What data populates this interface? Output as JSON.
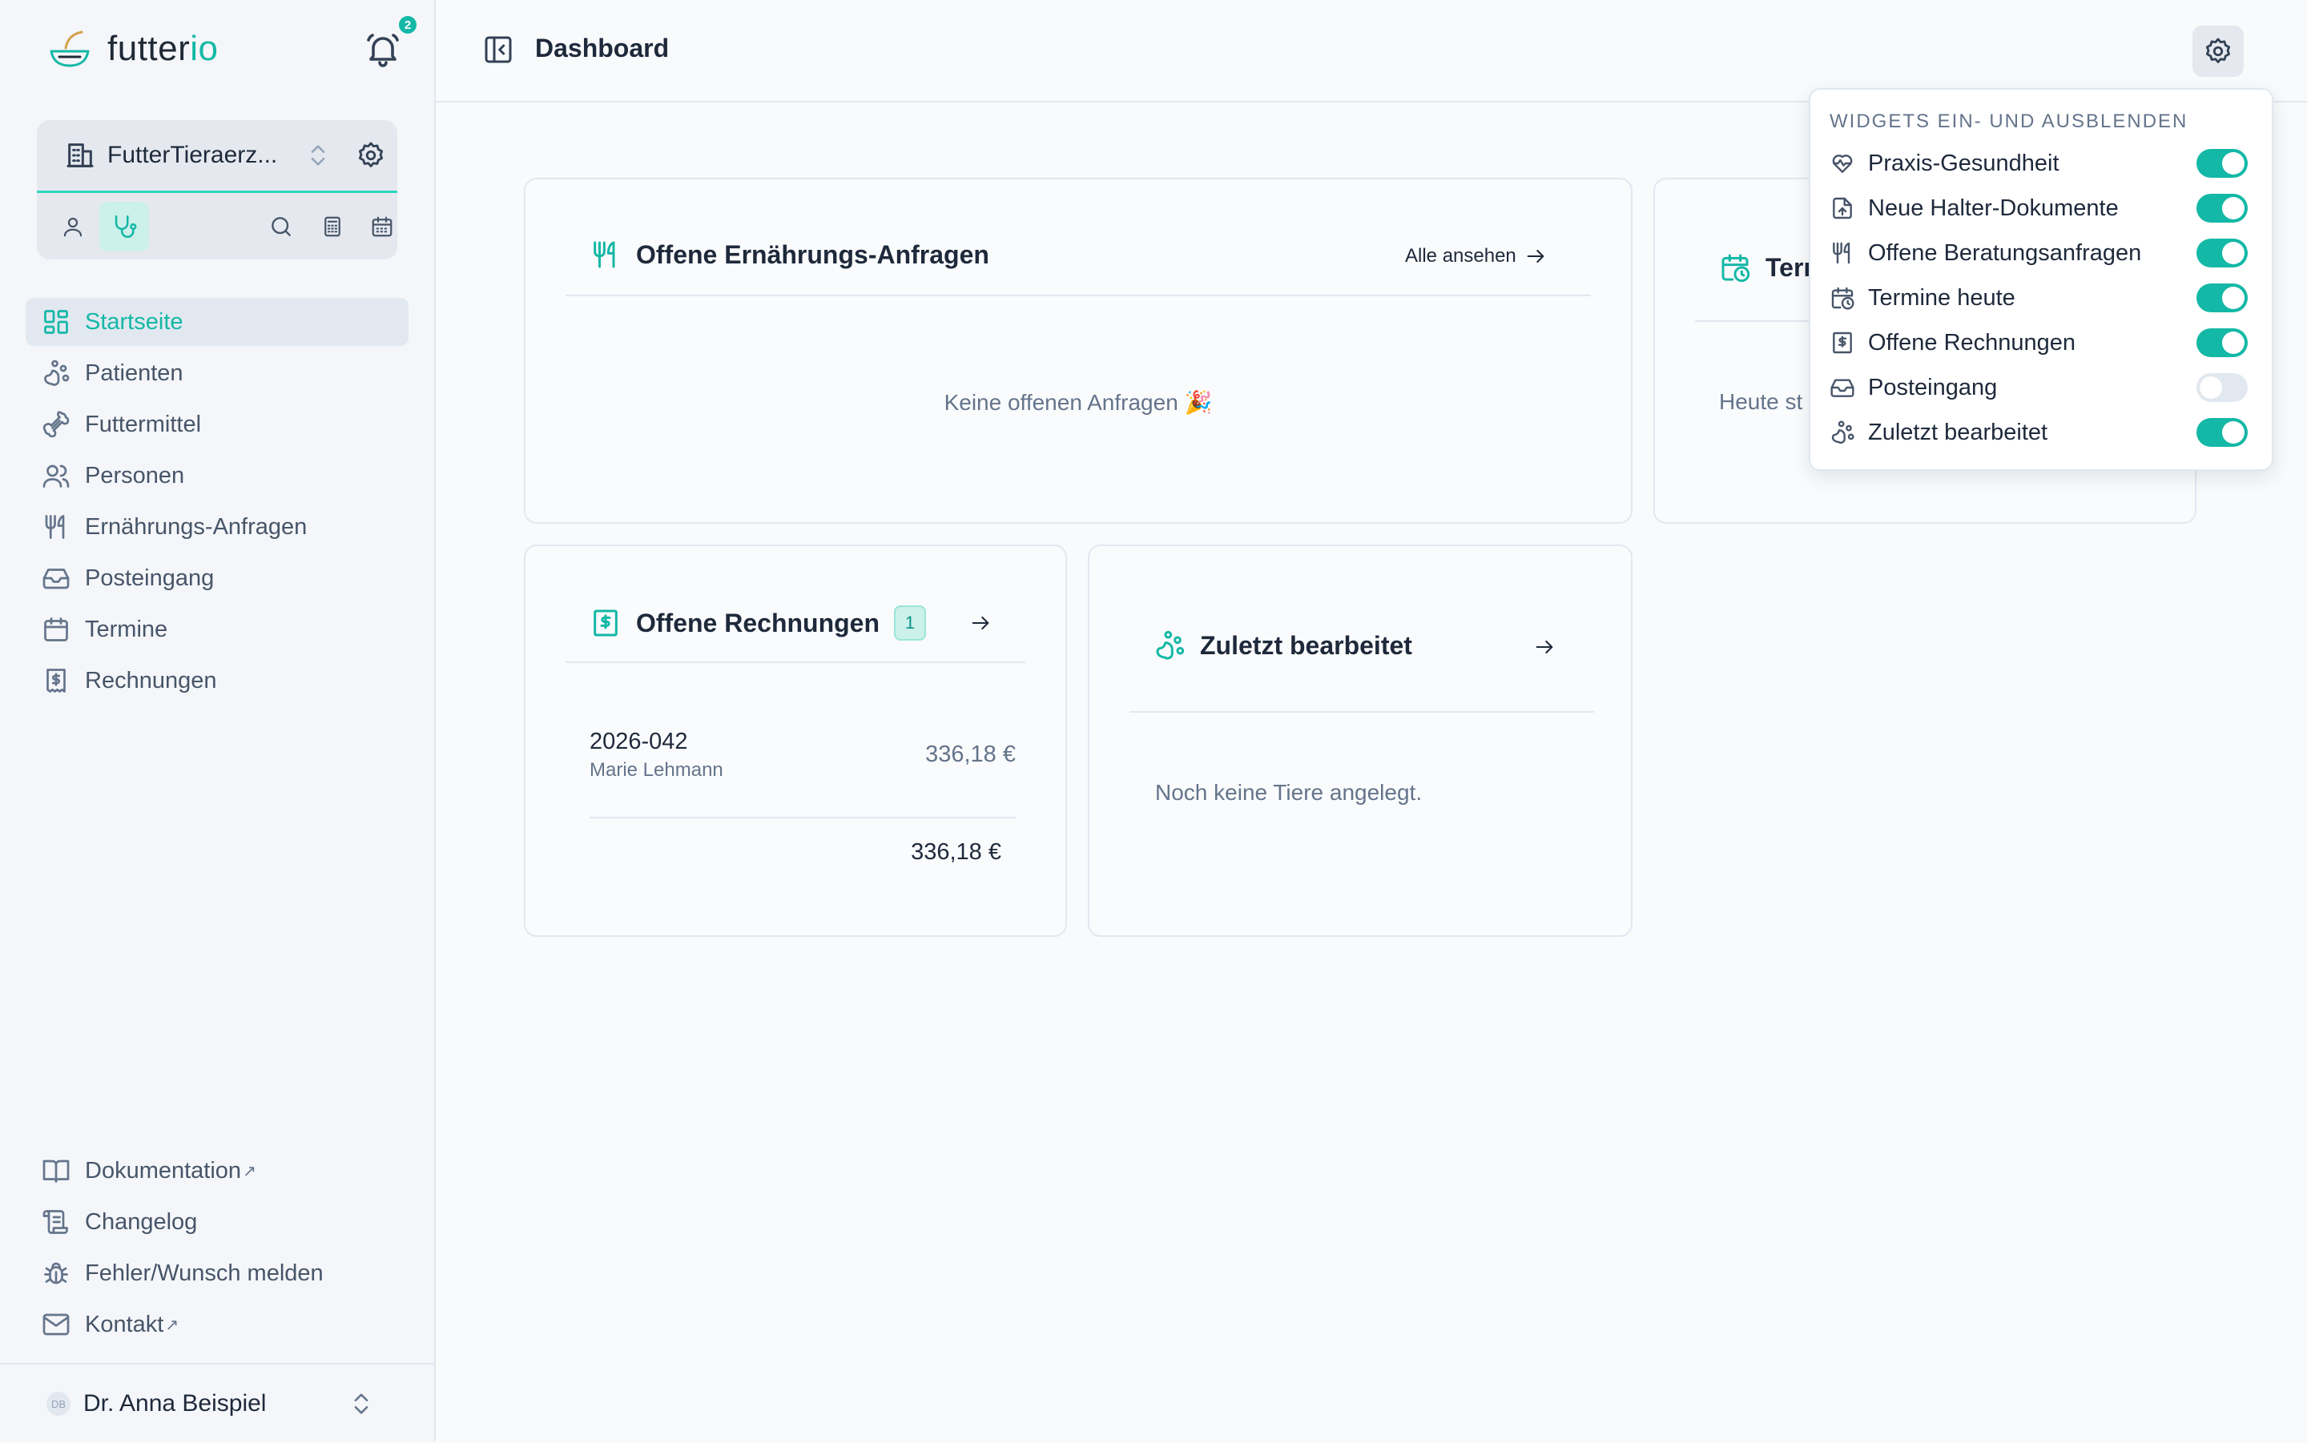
{
  "app": {
    "logo_text_main": "futter",
    "logo_text_accent": "io",
    "notification_count": "2"
  },
  "practice": {
    "name": "FutterTieraerz..."
  },
  "sidebar": {
    "nav": [
      {
        "label": "Startseite",
        "icon": "dashboard-grid-icon",
        "active": true
      },
      {
        "label": "Patienten",
        "icon": "paw-icon"
      },
      {
        "label": "Futtermittel",
        "icon": "bone-icon"
      },
      {
        "label": "Personen",
        "icon": "users-icon"
      },
      {
        "label": "Ernährungs-Anfragen",
        "icon": "utensils-icon"
      },
      {
        "label": "Posteingang",
        "icon": "inbox-icon"
      },
      {
        "label": "Termine",
        "icon": "calendar-icon"
      },
      {
        "label": "Rechnungen",
        "icon": "receipt-icon"
      }
    ],
    "footer": [
      {
        "label": "Dokumentation",
        "icon": "book-icon",
        "external": true
      },
      {
        "label": "Changelog",
        "icon": "scroll-icon"
      },
      {
        "label": "Fehler/Wunsch melden",
        "icon": "bug-icon"
      },
      {
        "label": "Kontakt",
        "icon": "mail-icon",
        "external": true
      }
    ],
    "external_glyph": "↗"
  },
  "user": {
    "initials": "DB",
    "name": "Dr. Anna Beispiel"
  },
  "header": {
    "title": "Dashboard"
  },
  "widgets": {
    "requests": {
      "title": "Offene Ernährungs-Anfragen",
      "link_label": "Alle ansehen",
      "empty_text": "Keine offenen Anfragen 🎉"
    },
    "appointments": {
      "title_partial": "Terı",
      "empty_partial": "Heute st"
    },
    "invoices": {
      "title": "Offene Rechnungen",
      "count": "1",
      "rows": [
        {
          "number": "2026-042",
          "customer": "Marie Lehmann",
          "amount": "336,18 €"
        }
      ],
      "total": "336,18 €"
    },
    "recent": {
      "title": "Zuletzt bearbeitet",
      "empty_text": "Noch keine Tiere angelegt."
    }
  },
  "widget_menu": {
    "heading": "WIDGETS EIN- UND AUSBLENDEN",
    "items": [
      {
        "label": "Praxis-Gesundheit",
        "icon": "heart-pulse-icon",
        "enabled": true
      },
      {
        "label": "Neue Halter-Dokumente",
        "icon": "file-upload-icon",
        "enabled": true
      },
      {
        "label": "Offene Beratungsanfragen",
        "icon": "utensils-icon",
        "enabled": true
      },
      {
        "label": "Termine heute",
        "icon": "calendar-clock-icon",
        "enabled": true
      },
      {
        "label": "Offene Rechnungen",
        "icon": "receipt-icon",
        "enabled": true
      },
      {
        "label": "Posteingang",
        "icon": "inbox-icon",
        "enabled": false
      },
      {
        "label": "Zuletzt bearbeitet",
        "icon": "paw-icon",
        "enabled": true
      }
    ]
  },
  "colors": {
    "accent": "#14b8a6",
    "text": "#1e293b",
    "muted": "#64748b",
    "background": "#f8fafc"
  }
}
